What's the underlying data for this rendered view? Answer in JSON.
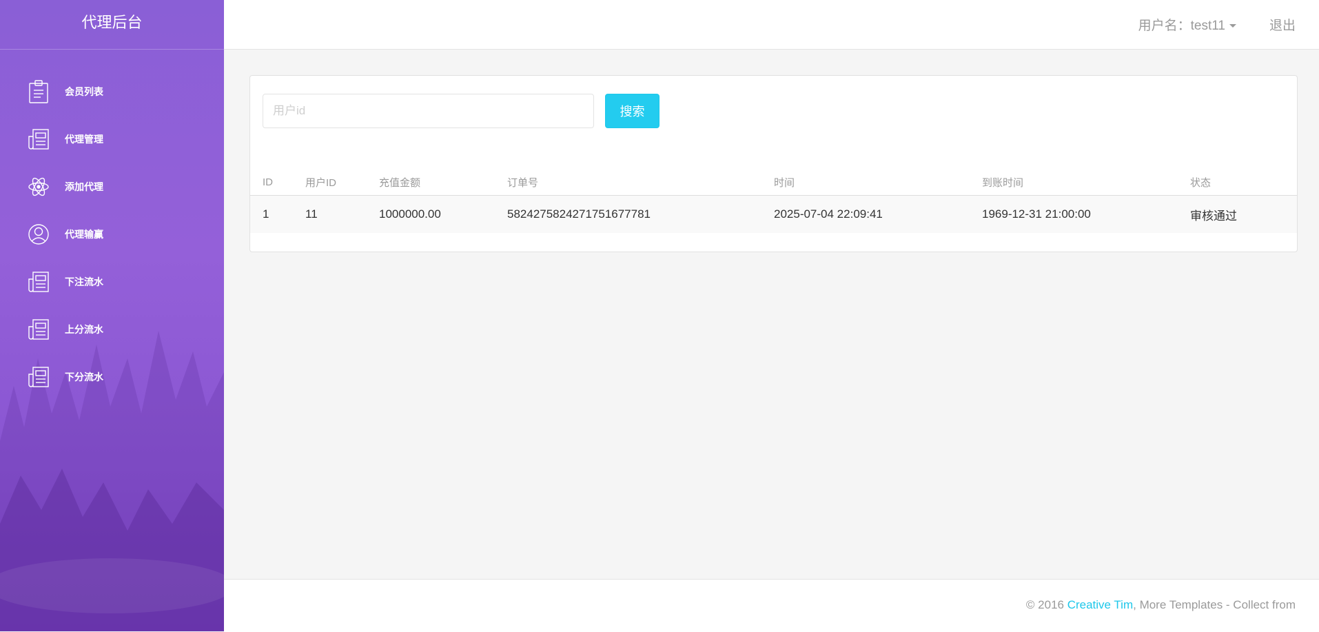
{
  "sidebar": {
    "brand": "代理后台",
    "items": [
      {
        "label": "会员列表",
        "icon": "clipboard-icon"
      },
      {
        "label": "代理管理",
        "icon": "news-icon"
      },
      {
        "label": "添加代理",
        "icon": "atom-icon"
      },
      {
        "label": "代理输赢",
        "icon": "user-circle-icon"
      },
      {
        "label": "下注流水",
        "icon": "news-icon"
      },
      {
        "label": "上分流水",
        "icon": "news-icon"
      },
      {
        "label": "下分流水",
        "icon": "news-icon"
      }
    ]
  },
  "header": {
    "user_label": "用户名：test11",
    "logout_label": "退出"
  },
  "search": {
    "placeholder": "用户id",
    "value": "",
    "button_label": "搜索"
  },
  "table": {
    "columns": [
      "ID",
      "用户ID",
      "充值金额",
      "订单号",
      "时间",
      "到账时间",
      "状态"
    ],
    "rows": [
      [
        "1",
        "11",
        "1000000.00",
        "5824275824271751677781",
        "2025-07-04 22:09:41",
        "1969-12-31 21:00:00",
        "审核通过"
      ]
    ]
  },
  "footer": {
    "prefix": "© 2016 ",
    "link": "Creative Tim",
    "suffix": ", More Templates - Collect from"
  },
  "colors": {
    "sidebar": "#9460d9",
    "accent": "#23ccef",
    "link": "#1dc7ea"
  }
}
